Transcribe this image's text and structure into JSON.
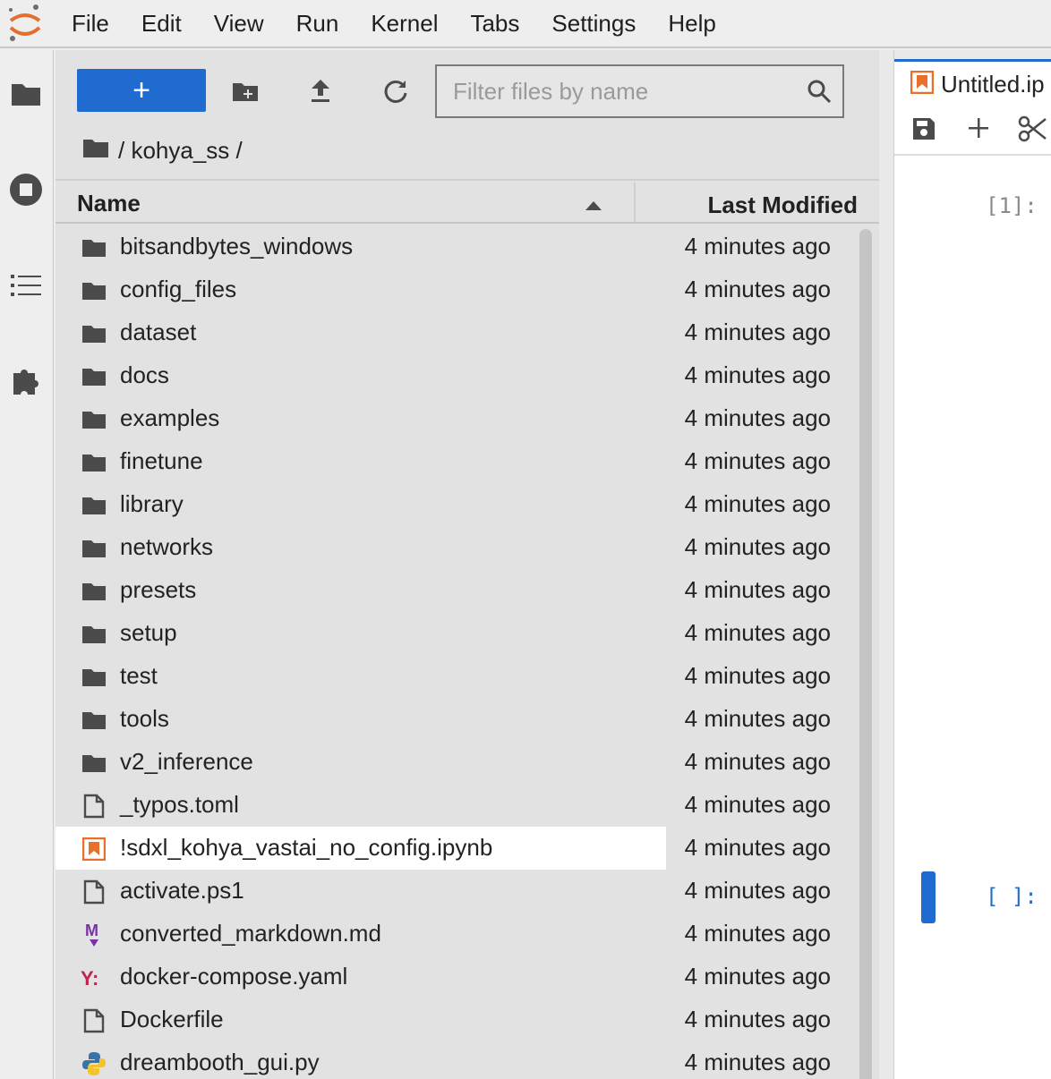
{
  "menubar": {
    "items": [
      "File",
      "Edit",
      "View",
      "Run",
      "Kernel",
      "Tabs",
      "Settings",
      "Help"
    ]
  },
  "activity_bar": {
    "icons": [
      "folder-icon",
      "running-icon",
      "toc-icon",
      "extension-icon"
    ]
  },
  "filebrowser": {
    "new_button_label": "+",
    "filter_placeholder": "Filter files by name",
    "breadcrumb": "/ kohya_ss /",
    "columns": {
      "name": "Name",
      "modified": "Last Modified"
    },
    "rows": [
      {
        "name": "bitsandbytes_windows",
        "modified": "4 minutes ago",
        "type": "folder"
      },
      {
        "name": "config_files",
        "modified": "4 minutes ago",
        "type": "folder"
      },
      {
        "name": "dataset",
        "modified": "4 minutes ago",
        "type": "folder"
      },
      {
        "name": "docs",
        "modified": "4 minutes ago",
        "type": "folder"
      },
      {
        "name": "examples",
        "modified": "4 minutes ago",
        "type": "folder"
      },
      {
        "name": "finetune",
        "modified": "4 minutes ago",
        "type": "folder"
      },
      {
        "name": "library",
        "modified": "4 minutes ago",
        "type": "folder"
      },
      {
        "name": "networks",
        "modified": "4 minutes ago",
        "type": "folder"
      },
      {
        "name": "presets",
        "modified": "4 minutes ago",
        "type": "folder"
      },
      {
        "name": "setup",
        "modified": "4 minutes ago",
        "type": "folder"
      },
      {
        "name": "test",
        "modified": "4 minutes ago",
        "type": "folder"
      },
      {
        "name": "tools",
        "modified": "4 minutes ago",
        "type": "folder"
      },
      {
        "name": "v2_inference",
        "modified": "4 minutes ago",
        "type": "folder"
      },
      {
        "name": "_typos.toml",
        "modified": "4 minutes ago",
        "type": "file"
      },
      {
        "name": "!sdxl_kohya_vastai_no_config.ipynb",
        "modified": "4 minutes ago",
        "type": "notebook",
        "selected": true
      },
      {
        "name": "activate.ps1",
        "modified": "4 minutes ago",
        "type": "file"
      },
      {
        "name": "converted_markdown.md",
        "modified": "4 minutes ago",
        "type": "markdown"
      },
      {
        "name": "docker-compose.yaml",
        "modified": "4 minutes ago",
        "type": "yaml"
      },
      {
        "name": "Dockerfile",
        "modified": "4 minutes ago",
        "type": "file"
      },
      {
        "name": "dreambooth_gui.py",
        "modified": "4 minutes ago",
        "type": "python"
      }
    ]
  },
  "notebook": {
    "tab_label": "Untitled.ip",
    "prompt_1": "[1]:",
    "prompt_2": "[ ]:"
  },
  "colors": {
    "accent": "#1f6bd0",
    "notebook_orange": "#e8702a",
    "markdown_purple": "#7b2fa8",
    "yaml_red": "#c0254f"
  }
}
